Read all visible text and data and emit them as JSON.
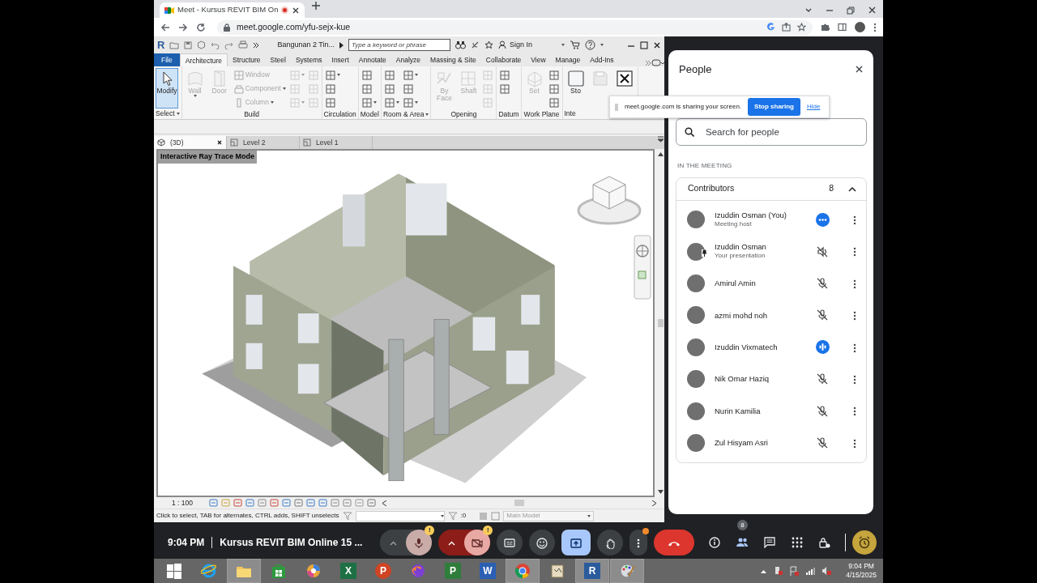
{
  "browser": {
    "tab": {
      "title": "Meet - Kursus REVIT BIM On",
      "recording": true,
      "selected": true
    },
    "url": "meet.google.com/yfu-sejx-kue"
  },
  "revit": {
    "logo": "R",
    "file_title": "Bangunan 2 Tin...",
    "search": {
      "placeholder": "Type a keyword or phrase"
    },
    "sign_in": "Sign In",
    "ribbon_tabs": [
      {
        "label": "File",
        "kind": "file",
        "selected": false
      },
      {
        "label": "Architecture",
        "kind": "tab",
        "selected": true
      },
      {
        "label": "Structure",
        "kind": "tab",
        "selected": false
      },
      {
        "label": "Steel",
        "kind": "tab",
        "selected": false
      },
      {
        "label": "Systems",
        "kind": "tab",
        "selected": false
      },
      {
        "label": "Insert",
        "kind": "tab",
        "selected": false
      },
      {
        "label": "Annotate",
        "kind": "tab",
        "selected": false
      },
      {
        "label": "Analyze",
        "kind": "tab",
        "selected": false
      },
      {
        "label": "Massing & Site",
        "kind": "tab",
        "selected": false
      },
      {
        "label": "Collaborate",
        "kind": "tab",
        "selected": false
      },
      {
        "label": "View",
        "kind": "tab",
        "selected": false
      },
      {
        "label": "Manage",
        "kind": "tab",
        "selected": false
      },
      {
        "label": "Add-Ins",
        "kind": "tab",
        "selected": false
      }
    ],
    "panels": [
      {
        "label": "Select",
        "dropdown": true,
        "tools": [
          {
            "kind": "modify",
            "label": "Modify",
            "selected": true,
            "disabled": false,
            "dropdown": false
          }
        ]
      },
      {
        "label": "Build",
        "dropdown": false,
        "tools": [
          {
            "kind": "wall",
            "label": "Wall",
            "selected": false,
            "disabled": true,
            "dropdown": true
          },
          {
            "kind": "door",
            "label": "Door",
            "selected": false,
            "disabled": true,
            "dropdown": false
          },
          {
            "kind": "window",
            "label": "Window",
            "selected": false,
            "disabled": true,
            "dropdown": false
          },
          {
            "kind": "component",
            "label": "Component",
            "selected": false,
            "disabled": true,
            "dropdown": true
          },
          {
            "kind": "column",
            "label": "Column",
            "selected": false,
            "disabled": true,
            "dropdown": true
          },
          {
            "kind": "icon",
            "selected": false,
            "disabled": true,
            "dropdown": true
          },
          {
            "kind": "icon",
            "selected": false,
            "disabled": true,
            "dropdown": false
          },
          {
            "kind": "icon",
            "selected": false,
            "disabled": true,
            "dropdown": true
          },
          {
            "kind": "icon",
            "selected": false,
            "disabled": true,
            "dropdown": false
          },
          {
            "kind": "icon",
            "selected": false,
            "disabled": true,
            "dropdown": false
          },
          {
            "kind": "icon",
            "selected": false,
            "disabled": true,
            "dropdown": false
          }
        ]
      },
      {
        "label": "Circulation",
        "dropdown": false,
        "tools": [
          {
            "kind": "icon",
            "selected": false,
            "disabled": false,
            "dropdown": true
          },
          {
            "kind": "icon",
            "selected": false,
            "disabled": false,
            "dropdown": false
          },
          {
            "kind": "icon",
            "selected": false,
            "disabled": false,
            "dropdown": false
          }
        ]
      },
      {
        "label": "Model",
        "dropdown": false,
        "tools": [
          {
            "kind": "icon",
            "selected": false,
            "disabled": false,
            "dropdown": false
          },
          {
            "kind": "icon",
            "selected": false,
            "disabled": false,
            "dropdown": false
          },
          {
            "kind": "icon",
            "selected": false,
            "disabled": false,
            "dropdown": true
          }
        ]
      },
      {
        "label": "Room & Area",
        "dropdown": true,
        "tools": [
          {
            "kind": "icon",
            "selected": false,
            "disabled": false,
            "dropdown": false
          },
          {
            "kind": "icon",
            "selected": false,
            "disabled": false,
            "dropdown": false
          },
          {
            "kind": "icon",
            "selected": false,
            "disabled": false,
            "dropdown": true
          },
          {
            "kind": "icon",
            "selected": false,
            "disabled": false,
            "dropdown": true
          },
          {
            "kind": "icon",
            "selected": false,
            "disabled": false,
            "dropdown": false
          },
          {
            "kind": "icon",
            "selected": false,
            "disabled": false,
            "dropdown": true
          }
        ]
      },
      {
        "label": "Opening",
        "dropdown": false,
        "tools": [
          {
            "kind": "by-face",
            "label": "By Face",
            "selected": false,
            "disabled": true,
            "dropdown": false
          },
          {
            "kind": "shaft",
            "label": "Shaft",
            "selected": false,
            "disabled": true,
            "dropdown": false
          },
          {
            "kind": "icon",
            "selected": false,
            "disabled": true,
            "dropdown": false
          },
          {
            "kind": "icon",
            "selected": false,
            "disabled": true,
            "dropdown": false
          },
          {
            "kind": "icon",
            "selected": false,
            "disabled": true,
            "dropdown": false
          }
        ]
      },
      {
        "label": "Datum",
        "dropdown": false,
        "tools": [
          {
            "kind": "icon",
            "selected": false,
            "disabled": false,
            "dropdown": false
          },
          {
            "kind": "icon",
            "selected": false,
            "disabled": false,
            "dropdown": false
          }
        ]
      },
      {
        "label": "Work Plane",
        "dropdown": false,
        "tools": [
          {
            "kind": "set",
            "label": "Set",
            "selected": false,
            "disabled": true,
            "dropdown": false
          },
          {
            "kind": "icon",
            "selected": false,
            "disabled": false,
            "dropdown": false
          },
          {
            "kind": "icon",
            "selected": false,
            "disabled": false,
            "dropdown": false
          },
          {
            "kind": "icon",
            "selected": false,
            "disabled": false,
            "dropdown": false
          }
        ]
      },
      {
        "label": "Inte",
        "dropdown": false,
        "tools": [
          {
            "kind": "stop",
            "label": "Sto",
            "selected": false,
            "disabled": false,
            "dropdown": false
          },
          {
            "kind": "save",
            "selected": false,
            "disabled": true,
            "dropdown": false
          },
          {
            "kind": "close",
            "selected": false,
            "disabled": false,
            "dropdown": false
          }
        ]
      }
    ],
    "view_tabs": [
      {
        "label": "(3D)",
        "kind": "model",
        "selected": true
      },
      {
        "label": "Level 2",
        "kind": "plan",
        "selected": false
      },
      {
        "label": "Level 1",
        "kind": "plan",
        "selected": false
      }
    ],
    "viewport": {
      "mode_label": "Interactive Ray Trace Mode"
    },
    "view_bar": {
      "scale": "1 : 100"
    },
    "status_bar": {
      "hint": "Click to select, TAB for alternates, CTRL adds, SHIFT unselects",
      "count": ":0",
      "model": "Main Model"
    }
  },
  "share_notice": {
    "text": "meet.google.com is sharing your screen.",
    "stop_button": "Stop sharing",
    "hide_link": "Hide"
  },
  "people_panel": {
    "title": "People",
    "search": {
      "placeholder": "Search for people"
    },
    "section": "IN THE MEETING",
    "group": {
      "label": "Contributors",
      "count": "8",
      "expanded": true,
      "people": [
        {
          "name": "Izuddin Osman (You)",
          "subtitle": "Meeting host",
          "kind": "dots",
          "pinned": false
        },
        {
          "name": "Izuddin Osman",
          "subtitle": "Your presentation",
          "kind": "speaker",
          "pinned": true
        },
        {
          "name": "Amirul Amin",
          "kind": "muted",
          "pinned": false
        },
        {
          "name": "azmi mohd noh",
          "kind": "muted",
          "pinned": false
        },
        {
          "name": "Izuddin Vixmatech",
          "kind": "speaking",
          "pinned": false
        },
        {
          "name": "Nik Omar Haziq",
          "kind": "muted",
          "pinned": false
        },
        {
          "name": "Nurin Kamilia",
          "kind": "muted",
          "pinned": false
        },
        {
          "name": "Zul Hisyam Asri",
          "kind": "muted",
          "pinned": false
        }
      ]
    }
  },
  "meet_bar": {
    "time": "9:04 PM",
    "title": "Kursus REVIT BIM Online 15 ...",
    "controls": [
      {
        "kind": "mic",
        "on": false,
        "warning": "!"
      },
      {
        "kind": "camera",
        "on": false,
        "warning": "!"
      },
      {
        "kind": "captions",
        "on": false
      },
      {
        "kind": "reactions",
        "on": false
      },
      {
        "kind": "present",
        "on": true
      },
      {
        "kind": "hand",
        "on": false
      },
      {
        "kind": "more",
        "notification": true
      },
      {
        "kind": "end"
      }
    ],
    "side": [
      {
        "kind": "info",
        "selected": false
      },
      {
        "kind": "people",
        "selected": true,
        "badge": "8"
      },
      {
        "kind": "chat",
        "selected": false
      },
      {
        "kind": "activities",
        "selected": false
      },
      {
        "kind": "host",
        "selected": false
      },
      {
        "kind": "timer",
        "selected": false
      }
    ]
  },
  "taskbar": {
    "apps": [
      {
        "kind": "start",
        "active": false
      },
      {
        "kind": "web",
        "active": false
      },
      {
        "kind": "folder",
        "active": true
      },
      {
        "kind": "store",
        "active": false
      },
      {
        "kind": "swirl",
        "active": false
      },
      {
        "kind": "tile",
        "glyph": "X",
        "active": false,
        "color": "#1d7044"
      },
      {
        "kind": "round",
        "glyph": "P",
        "active": false,
        "color": "#d04423"
      },
      {
        "kind": "fox",
        "active": false
      },
      {
        "kind": "tile",
        "glyph": "P",
        "active": false,
        "color": "#2f7d3a"
      },
      {
        "kind": "tile",
        "glyph": "W",
        "active": false,
        "color": "#2b5fb4"
      },
      {
        "kind": "chrome",
        "active": true
      },
      {
        "kind": "scroll",
        "active": false
      },
      {
        "kind": "tile",
        "glyph": "R",
        "active": true,
        "color": "#2a5b9c"
      },
      {
        "kind": "palette",
        "active": true
      }
    ],
    "clock": {
      "time": "9:04 PM",
      "date": "4/15/2025"
    }
  }
}
